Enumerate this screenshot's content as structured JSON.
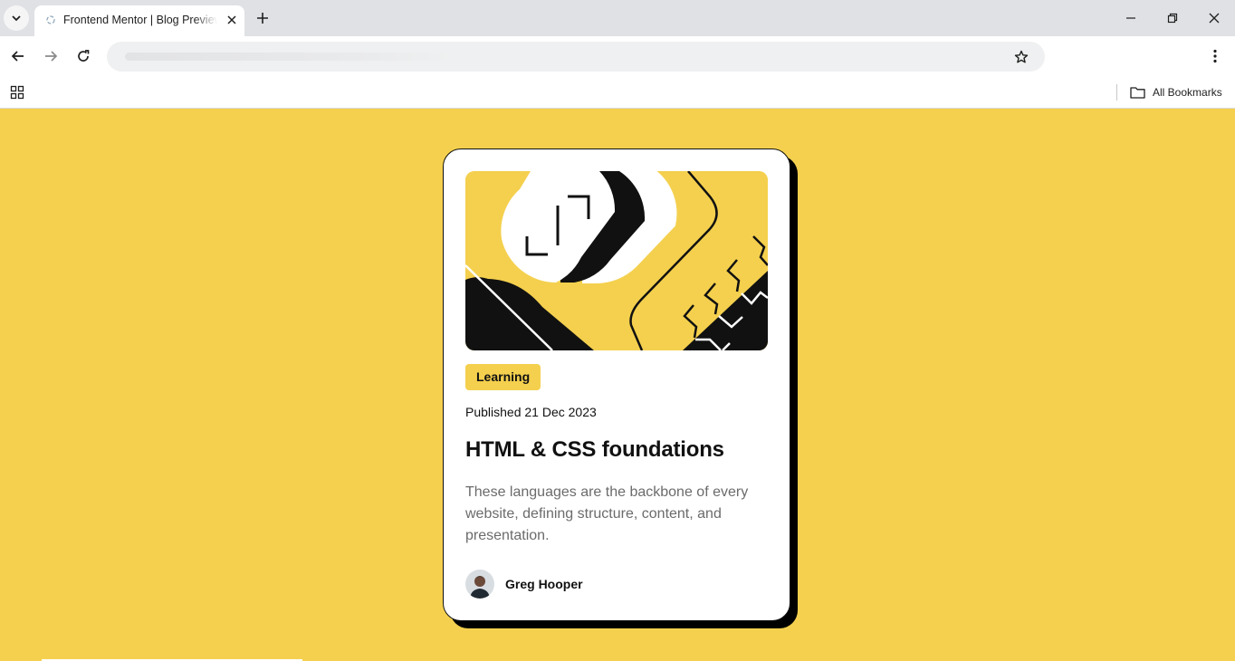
{
  "browser": {
    "tab": {
      "title": "Frontend Mentor | Blog Preview Card"
    },
    "bookmarks_bar": {
      "all_bookmarks_label": "All Bookmarks"
    }
  },
  "icons": [
    "chevron-down-icon",
    "favicon-icon",
    "close-icon",
    "plus-icon",
    "minimize-icon",
    "restore-icon",
    "back-arrow-icon",
    "forward-arrow-icon",
    "reload-icon",
    "star-icon",
    "kebab-menu-icon",
    "apps-grid-icon",
    "folder-icon"
  ],
  "colors": {
    "page_background": "#f4d04e",
    "card_background": "#ffffff",
    "card_shadow": "#000000",
    "text_primary": "#111111",
    "text_secondary": "#6b6b6b"
  },
  "card": {
    "tag": "Learning",
    "published": "Published 21 Dec 2023",
    "title": "HTML & CSS foundations",
    "description": "These languages are the backbone of every website, defining structure, content, and presentation.",
    "author": {
      "name": "Greg Hooper"
    }
  }
}
